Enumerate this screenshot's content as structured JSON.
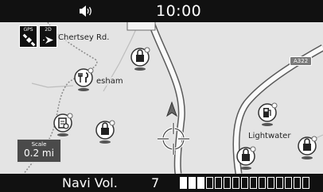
{
  "status_bar": {
    "clock": "10:00",
    "volume_icon": "speaker-volume-icon"
  },
  "map_mode_buttons": [
    {
      "label": "GPS",
      "icon": "gps-satellite-icon"
    },
    {
      "label": "2D",
      "icon": "2d-heading-arrow-icon"
    }
  ],
  "map": {
    "road_labels": {
      "chertsey": "Chertsey Rd.",
      "lightwater": "Lightwater",
      "esham": "esham"
    },
    "road_badges": {
      "a322": "A322"
    },
    "poi_icons": [
      "shopping-bag-poi-icon",
      "restaurant-poi-icon",
      "clipboard-poi-icon",
      "shopping-bag-poi-icon",
      "fuel-station-poi-icon",
      "shopping-bag-poi-icon",
      "shopping-bag-poi-icon"
    ],
    "vehicle_icon": "vehicle-position-icon",
    "cursor_icon": "crosshair-cursor-icon"
  },
  "scale": {
    "title": "Scale",
    "value": "0.2 mi"
  },
  "volume_bar": {
    "label": "Navi Vol.",
    "value": "7",
    "level": 3,
    "segments_total": 15
  },
  "colors": {
    "bar_background": "#111111",
    "map_background": "#e4e4e4",
    "road": "#ffffff",
    "road_edge": "#5a5a5a",
    "route_dotted": "#9a9a9a"
  }
}
